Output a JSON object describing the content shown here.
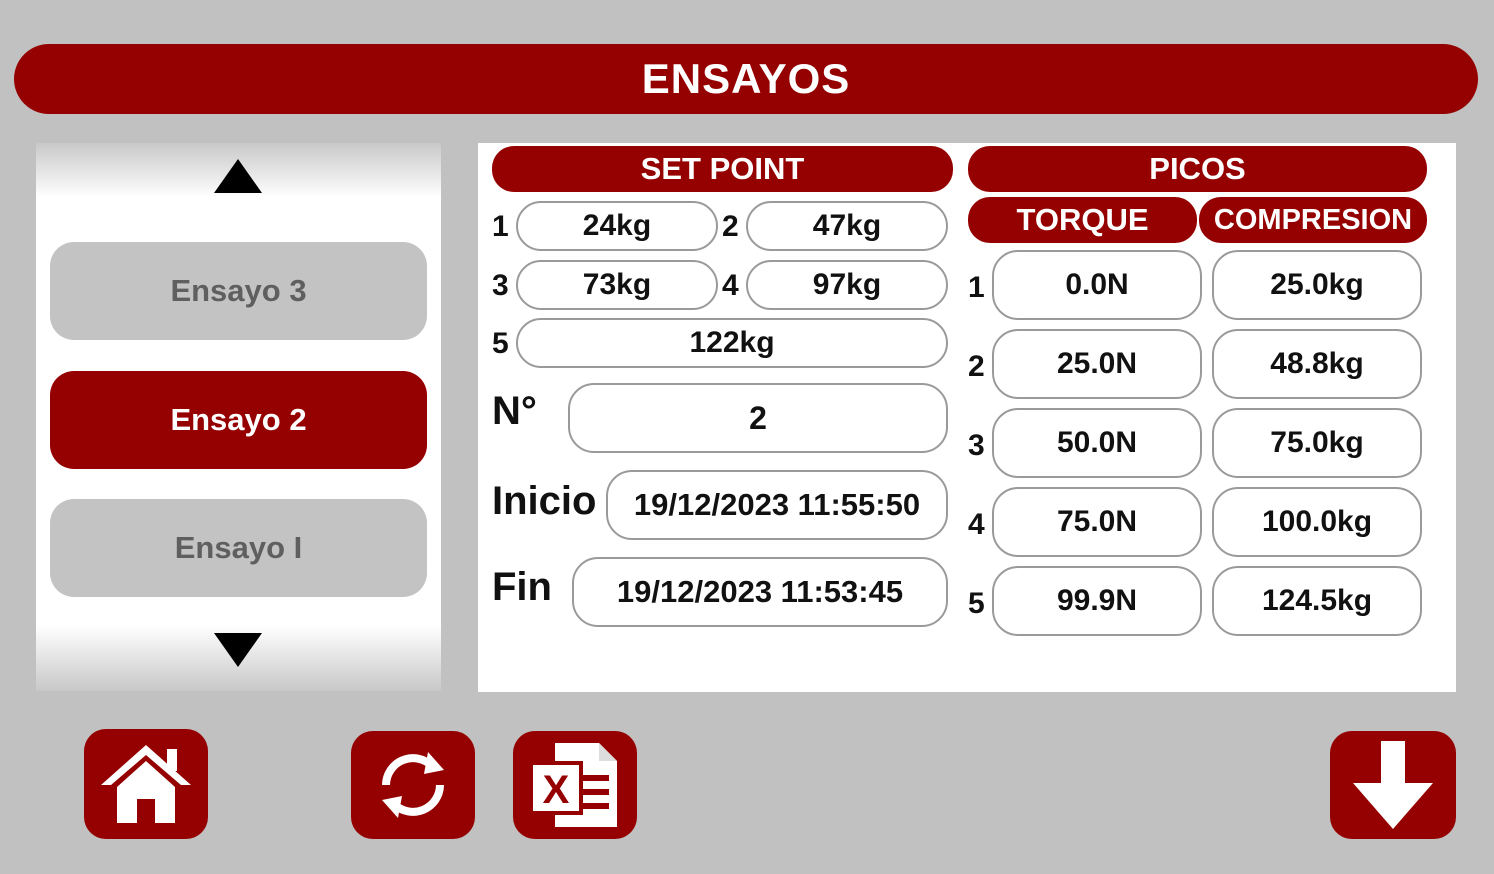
{
  "header": {
    "title": "ENSAYOS"
  },
  "test_list": {
    "items": [
      {
        "label": "Ensayo 3",
        "state": "inactive"
      },
      {
        "label": "Ensayo 2",
        "state": "active"
      },
      {
        "label": "Ensayo I",
        "state": "inactive"
      }
    ]
  },
  "set_point": {
    "title": "SET POINT",
    "rows": [
      {
        "index": "1",
        "value": "24kg"
      },
      {
        "index": "2",
        "value": "47kg"
      },
      {
        "index": "3",
        "value": "73kg"
      },
      {
        "index": "4",
        "value": "97kg"
      },
      {
        "index": "5",
        "value": "122kg"
      }
    ],
    "number_label": "N°",
    "number_value": "2",
    "start_label": "Inicio",
    "start_value": "19/12/2023 11:55:50",
    "end_label": "Fin",
    "end_value": "19/12/2023 11:53:45"
  },
  "picos": {
    "title": "PICOS",
    "torque_header": "TORQUE",
    "compression_header": "COMPRESION",
    "rows": [
      {
        "index": "1",
        "torque": "0.0N",
        "compression": "25.0kg"
      },
      {
        "index": "2",
        "torque": "25.0N",
        "compression": "48.8kg"
      },
      {
        "index": "3",
        "torque": "50.0N",
        "compression": "75.0kg"
      },
      {
        "index": "4",
        "torque": "75.0N",
        "compression": "100.0kg"
      },
      {
        "index": "5",
        "torque": "99.9N",
        "compression": "124.5kg"
      }
    ]
  },
  "toolbar": {
    "home_icon": "home-icon",
    "refresh_icon": "refresh-icon",
    "excel_icon": "excel-icon",
    "download_icon": "download-arrow-icon"
  },
  "colors": {
    "accent": "#950000",
    "background": "#c1c1c1",
    "inactive_item": "#c3c3c3"
  }
}
